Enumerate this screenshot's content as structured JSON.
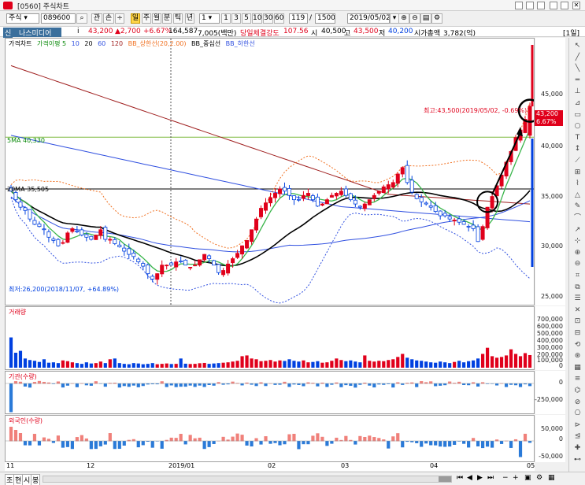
{
  "window": {
    "title": "[0560] 주식차트"
  },
  "toolbar": {
    "market": "주식",
    "code": "089600",
    "btn_chart": "관",
    "btn_compare": "손",
    "period_buttons": [
      "주",
      "월",
      "분",
      "틱",
      "년"
    ],
    "active_period": "일",
    "interval_value": "1",
    "minute_buttons": [
      "1",
      "3",
      "5",
      "10",
      "30",
      "60"
    ],
    "count_value": "119",
    "count_total": "1500",
    "date_value": "2019/05/02"
  },
  "info": {
    "name": "나스미디어",
    "price": "43,200",
    "change": "▲2,700",
    "rate": "+6.67%",
    "volume": "164,587",
    "amount": "7,005(백만)",
    "strength_label": "당일체결강도",
    "strength_value": "107.56",
    "open_label": "시",
    "open_value": "40,500",
    "high_label": "고",
    "high_value": "43,500",
    "low_label": "저",
    "low_value": "40,200",
    "mcap_label": "시가총액",
    "mcap_value": "3,782(억)",
    "interval_label": "[1일]"
  },
  "price_pane": {
    "legend": [
      "가격차트",
      "가격이평 5",
      "10",
      "20",
      "60",
      "120",
      "BB_상한선(20,2.00)",
      "BB_중심선",
      "BB_하한선"
    ],
    "ma5_label": "5MA 40,330",
    "ma20_label": "20MA 35,505",
    "high_annotation": "최고:43,500(2019/05/02, -0.69%)",
    "low_annotation": "최저:26,200(2018/11/07, +64.89%)",
    "current_price_tag": "43,200",
    "current_rate_tag": "6.67%",
    "y_ticks": [
      "45,000",
      "40,000",
      "35,000",
      "30,000",
      "25,000"
    ]
  },
  "volume_pane": {
    "legend": "거래량",
    "y_ticks": [
      "700,000",
      "600,000",
      "500,000",
      "400,000",
      "300,000",
      "200,000",
      "100,000",
      "0"
    ]
  },
  "inst_pane": {
    "legend": "기관(수량)",
    "y_ticks": [
      "0",
      "-250,000"
    ]
  },
  "foreign_pane": {
    "legend": "외국인(수량)",
    "y_ticks": [
      "50,000",
      "0",
      "-50,000"
    ]
  },
  "date_axis": [
    "11",
    "12",
    "2019/01",
    "02",
    "03",
    "04",
    "05"
  ],
  "bottom": {
    "tabs": [
      "조",
      "현",
      "시",
      "봉"
    ]
  },
  "colors": {
    "up": "#e0001b",
    "down": "#0040e0",
    "ma5": "#39b54a",
    "ma20": "#000000",
    "bb_upper": "#f07020",
    "bb_lower": "#3050e0",
    "ma120": "#a02020"
  },
  "chart_data": {
    "type": "candlestick",
    "ylim": [
      25000,
      48500
    ],
    "close": [
      35300,
      34500,
      33800,
      33500,
      32700,
      32200,
      32000,
      31700,
      31000,
      30700,
      30200,
      30500,
      31400,
      31800,
      31500,
      31200,
      31000,
      30800,
      31200,
      31700,
      30800,
      30800,
      30400,
      30100,
      29700,
      29400,
      29200,
      28700,
      28300,
      27600,
      27100,
      27600,
      28400,
      28400,
      28400,
      28700,
      28700,
      28400,
      28200,
      28400,
      28900,
      29400,
      29000,
      28400,
      27700,
      27900,
      28500,
      29000,
      29500,
      30200,
      30700,
      31700,
      32700,
      33700,
      34200,
      34700,
      35100,
      35500,
      35300,
      34900,
      34500,
      34500,
      34900,
      35100,
      34500,
      33900,
      34100,
      34500,
      34900,
      35100,
      35300,
      34900,
      34500,
      34100,
      33800,
      34100,
      34500,
      34900,
      35300,
      35700,
      35900,
      36100,
      36900,
      37500,
      36100,
      35200,
      34600,
      34300,
      34100,
      33800,
      33400,
      33000,
      33000,
      32700,
      32600,
      32400,
      32200,
      32000,
      31800,
      30600,
      32000,
      33800,
      34800,
      35800,
      36800,
      38000,
      39000,
      40300,
      41000,
      42000,
      43200
    ],
    "volume": [
      395000,
      195000,
      220000,
      120000,
      100000,
      90000,
      75000,
      110000,
      65000,
      70000,
      60000,
      95000,
      85000,
      70000,
      60000,
      50000,
      70000,
      55000,
      60000,
      80000,
      60000,
      110000,
      120000,
      60000,
      50000,
      45000,
      60000,
      55000,
      45000,
      50000,
      60000,
      45000,
      50000,
      55000,
      48000,
      50000,
      120000,
      52000,
      48000,
      50000,
      58000,
      62000,
      50000,
      55000,
      60000,
      65000,
      70000,
      80000,
      90000,
      150000,
      160000,
      120000,
      110000,
      85000,
      90000,
      100000,
      80000,
      95000,
      88000,
      110000,
      90000,
      80000,
      95000,
      70000,
      75000,
      85000,
      65000,
      70000,
      90000,
      120000,
      100000,
      85000,
      95000,
      80000,
      70000,
      160000,
      90000,
      80000,
      90000,
      85000,
      100000,
      110000,
      140000,
      180000,
      130000,
      110000,
      95000,
      90000,
      80000,
      70000,
      65000,
      80000,
      70000,
      60000,
      75000,
      90000,
      70000,
      85000,
      95000,
      120000,
      180000,
      260000,
      150000,
      130000,
      140000,
      160000,
      240000,
      180000,
      150000,
      190000,
      164587
    ]
  }
}
